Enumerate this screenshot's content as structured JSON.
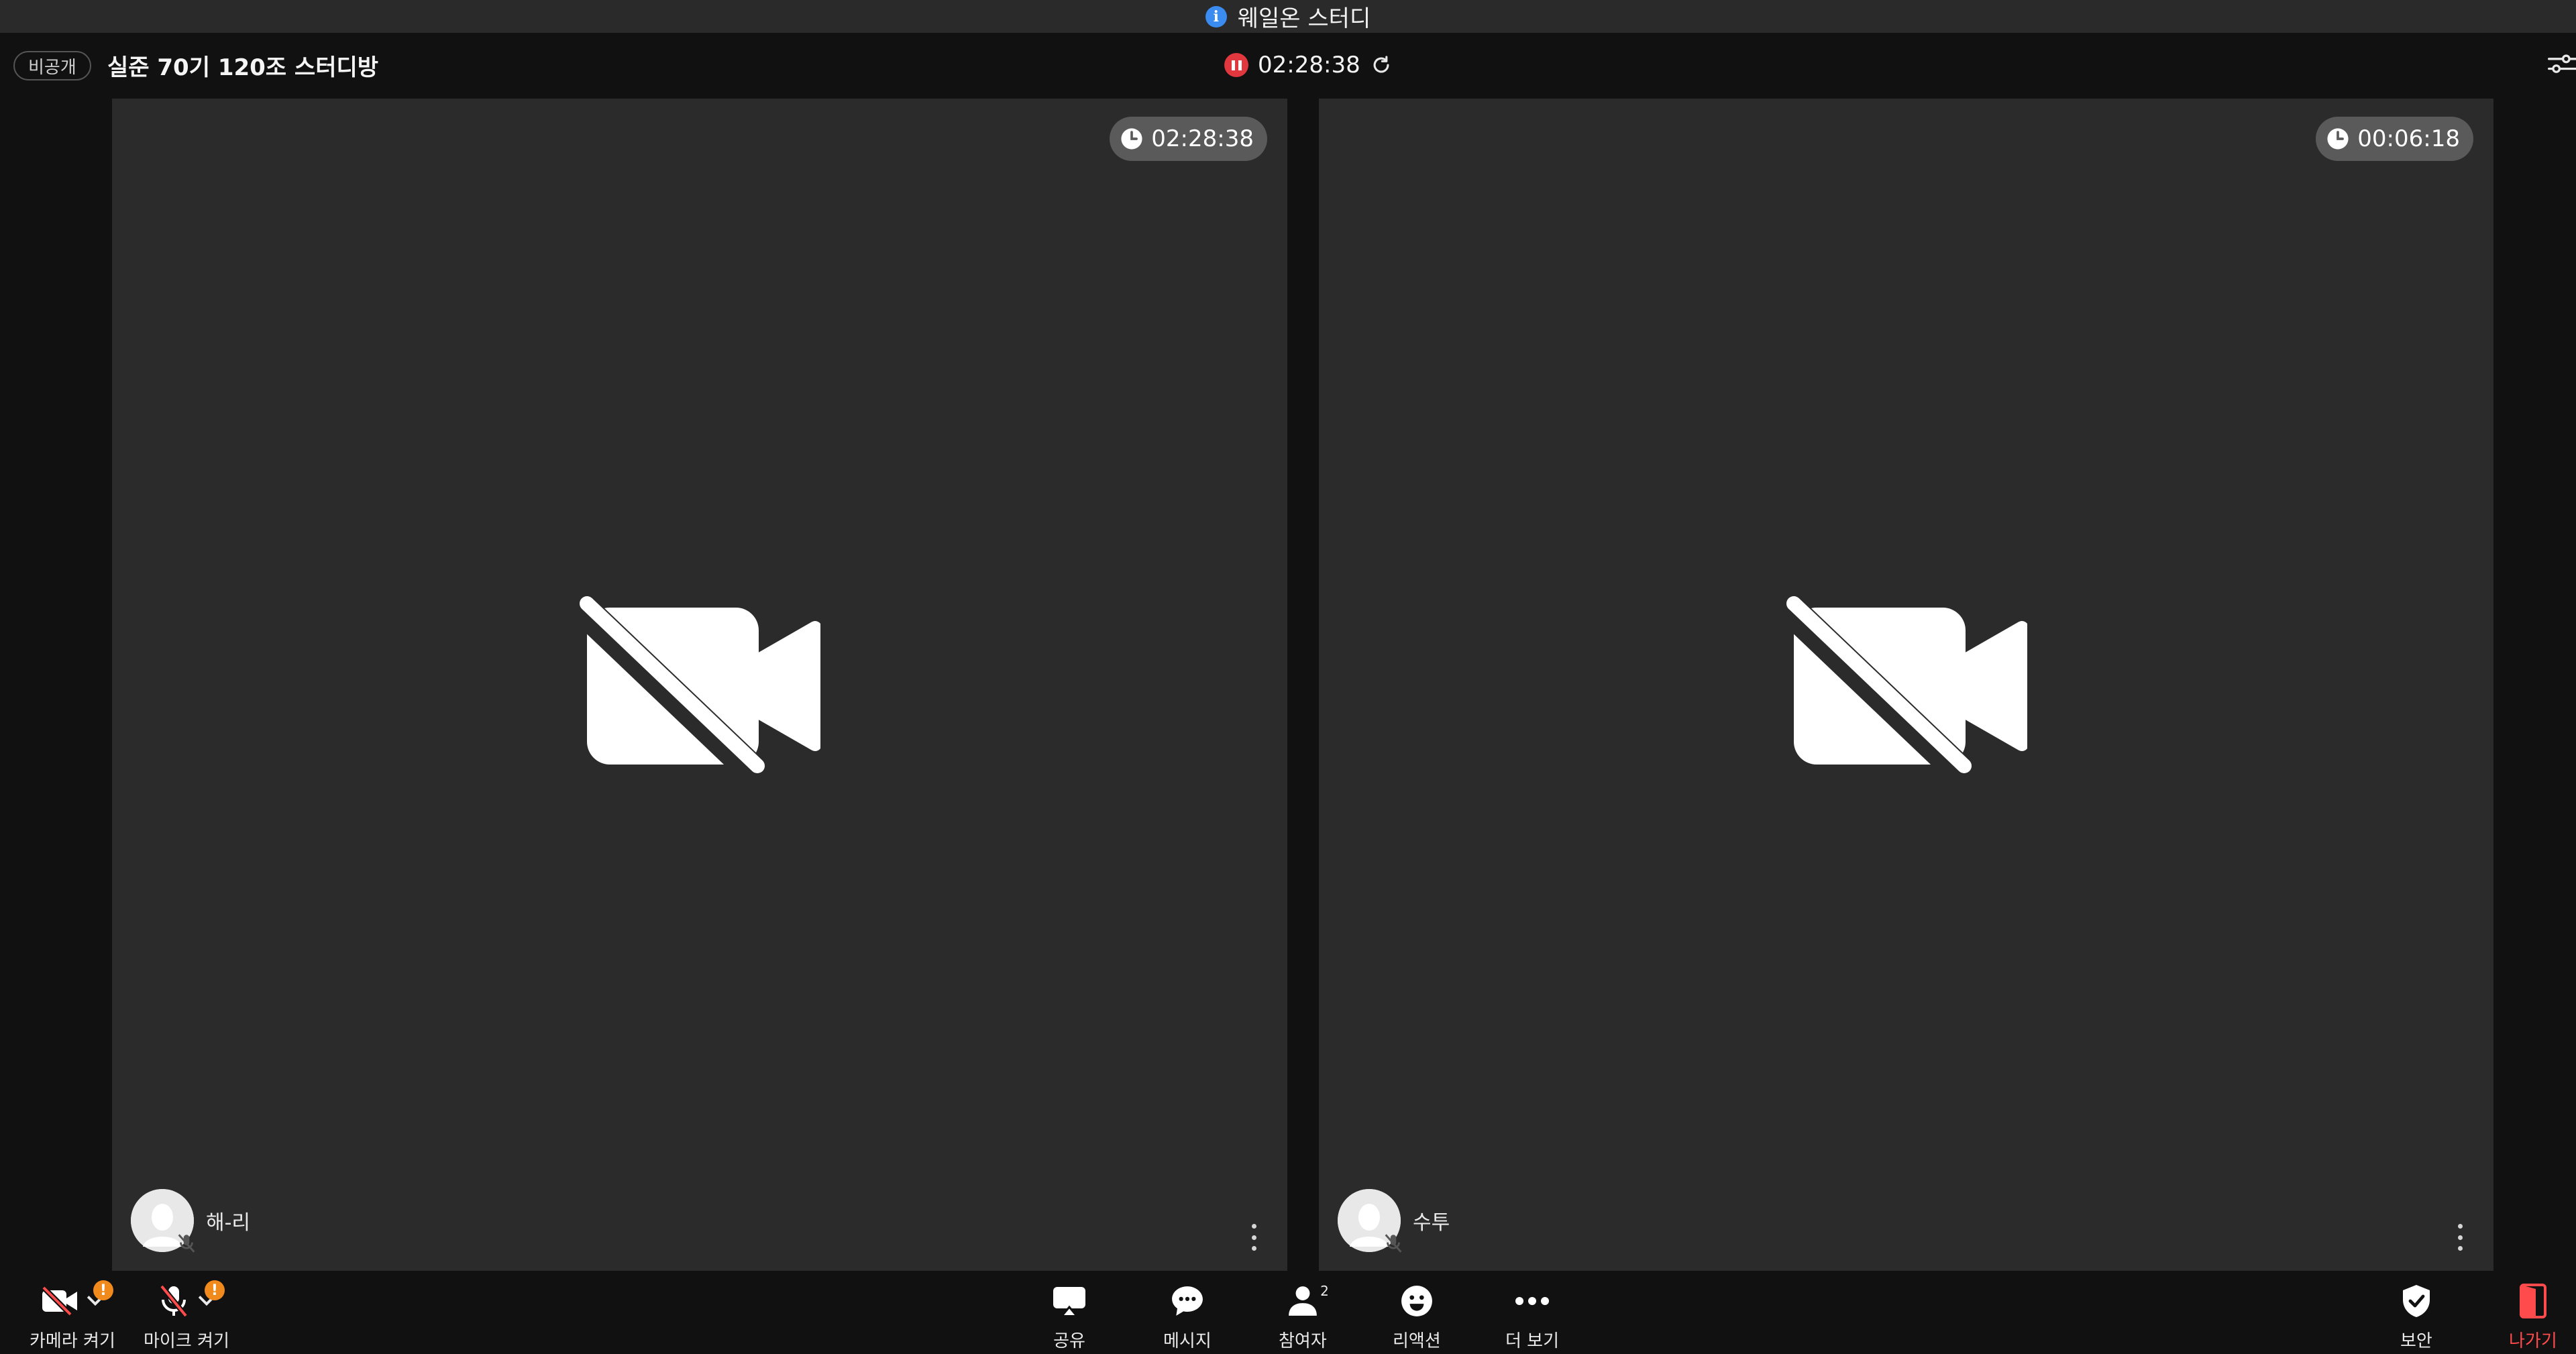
{
  "app_banner": {
    "title": "웨일온 스터디",
    "icon": "info-icon"
  },
  "header": {
    "privacy_badge": "비공개",
    "room_title": "실준 70기 120조 스터디방",
    "recording_time": "02:28:38"
  },
  "tiles": [
    {
      "timer": "02:28:38",
      "name": "해-리",
      "camera": "off",
      "mic": "muted"
    },
    {
      "timer": "00:06:18",
      "name": "수투",
      "camera": "off",
      "mic": "muted"
    }
  ],
  "toolbar": {
    "camera_label": "카메라 켜기",
    "mic_label": "마이크 켜기",
    "share_label": "공유",
    "message_label": "메시지",
    "participants_label": "참여자",
    "participants_count": "2",
    "reaction_label": "리액션",
    "more_label": "더 보기",
    "security_label": "보안",
    "leave_label": "나가기",
    "warning_mark": "!"
  },
  "colors": {
    "record_red": "#e0383e",
    "warning_orange": "#f08a1c",
    "leave_red": "#ff4b4b",
    "info_blue": "#3a8cf0",
    "tile_bg": "#2b2b2b"
  }
}
